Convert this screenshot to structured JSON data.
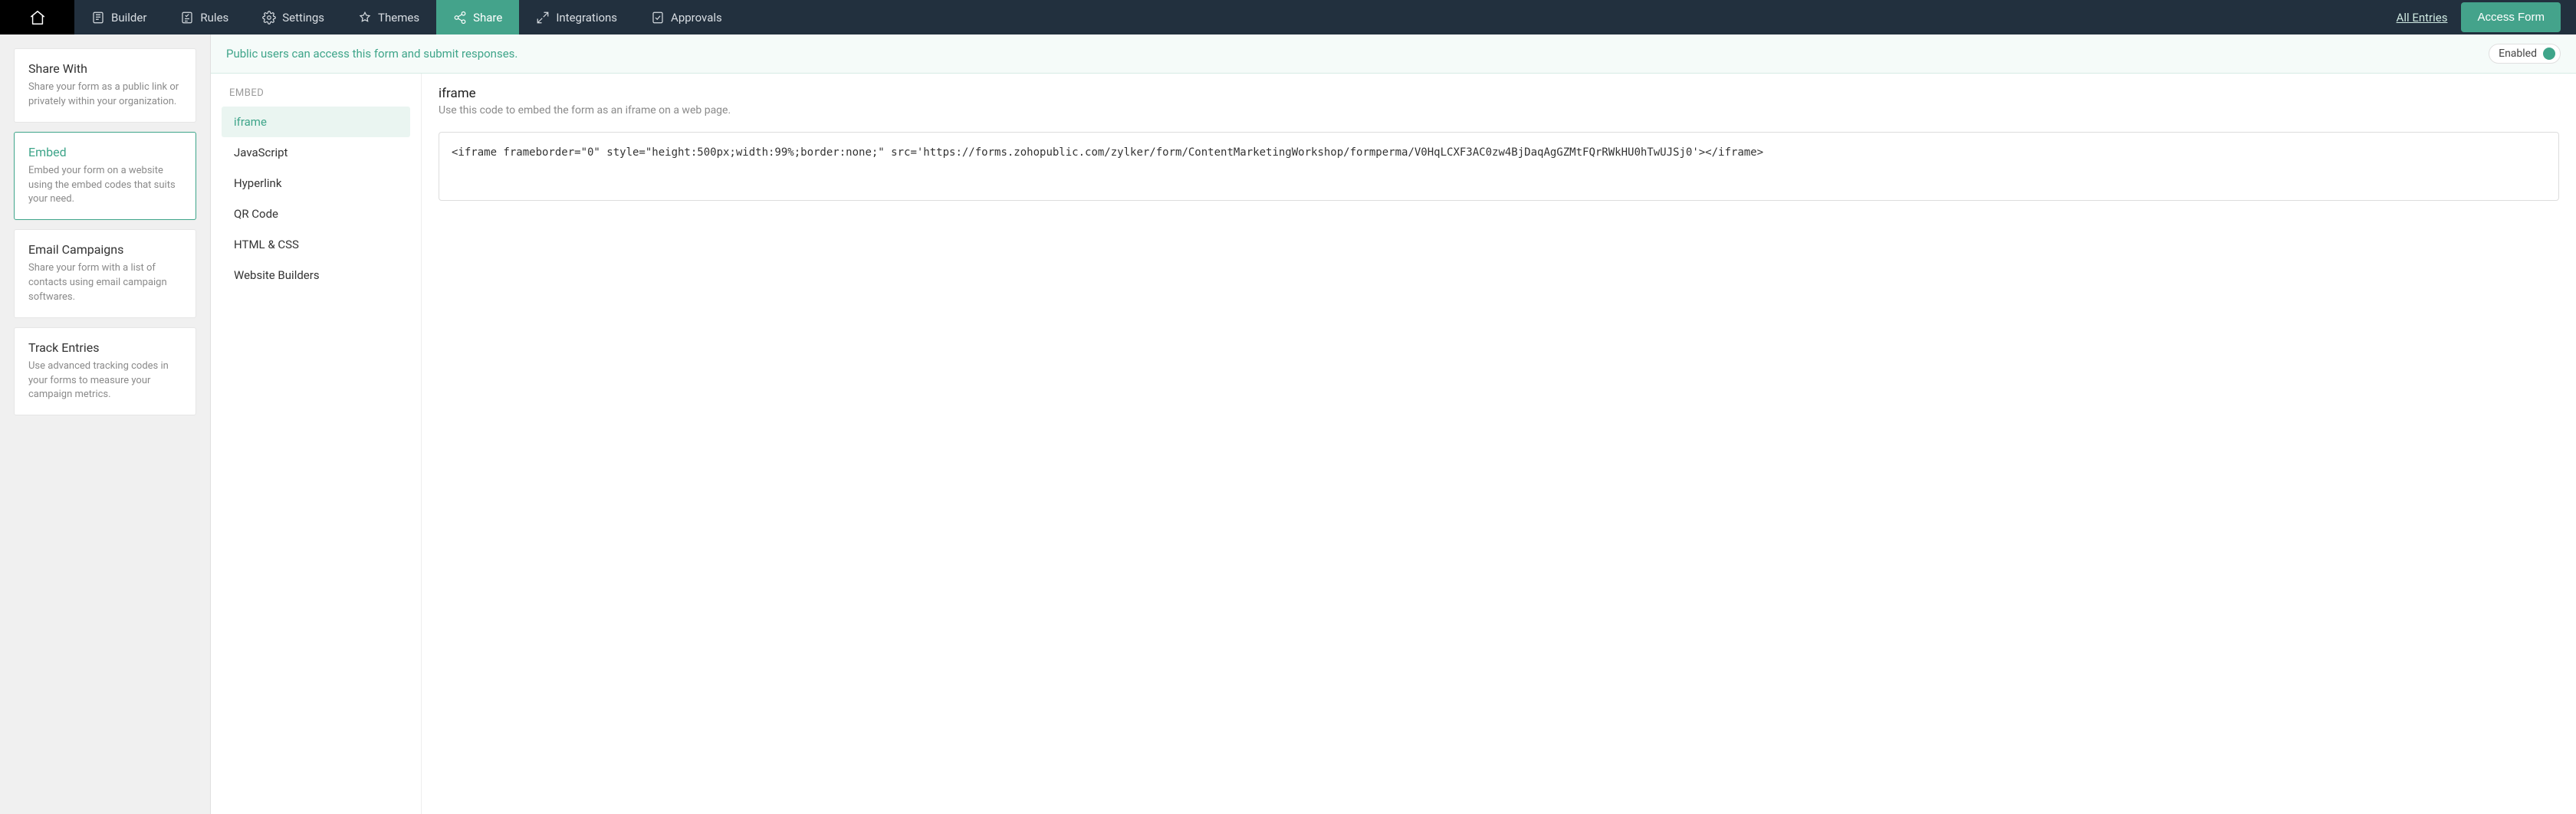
{
  "topnav": {
    "tabs": [
      {
        "label": "Builder"
      },
      {
        "label": "Rules"
      },
      {
        "label": "Settings"
      },
      {
        "label": "Themes"
      },
      {
        "label": "Share"
      },
      {
        "label": "Integrations"
      },
      {
        "label": "Approvals"
      }
    ],
    "all_entries": "All Entries",
    "access_form": "Access Form"
  },
  "banner": {
    "text": "Public users can access this form and submit responses.",
    "toggle_label": "Enabled"
  },
  "sidebar": {
    "cards": [
      {
        "title": "Share With",
        "desc": "Share your form as a public link or privately within your organization."
      },
      {
        "title": "Embed",
        "desc": "Embed your form on a website using the embed codes that suits your need."
      },
      {
        "title": "Email Campaigns",
        "desc": "Share your form with a list of contacts using email campaign softwares."
      },
      {
        "title": "Track Entries",
        "desc": "Use advanced tracking codes in your forms to measure your campaign metrics."
      }
    ]
  },
  "subnav": {
    "header": "EMBED",
    "items": [
      {
        "label": "iframe"
      },
      {
        "label": "JavaScript"
      },
      {
        "label": "Hyperlink"
      },
      {
        "label": "QR Code"
      },
      {
        "label": "HTML & CSS"
      },
      {
        "label": "Website Builders"
      }
    ]
  },
  "detail": {
    "title": "iframe",
    "subtitle": "Use this code to embed the form as an iframe on a web page.",
    "code": "<iframe frameborder=\"0\" style=\"height:500px;width:99%;border:none;\" src='https://forms.zohopublic.com/zylker/form/ContentMarketingWorkshop/formperma/V0HqLCXF3AC0zw4BjDaqAgGZMtFQrRWkHU0hTwUJSj0'></iframe>"
  }
}
